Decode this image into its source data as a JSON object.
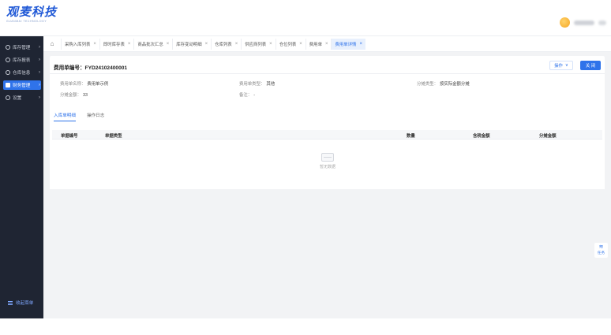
{
  "header": {
    "logo_text": "观麦科技",
    "logo_sub": "GUANMAI TECHNOLOGY"
  },
  "sidebar": {
    "items": [
      {
        "label": "库存管理",
        "icon": "box-icon",
        "active": false
      },
      {
        "label": "库存报表",
        "icon": "chart-icon",
        "active": false
      },
      {
        "label": "仓库信息",
        "icon": "warehouse-icon",
        "active": false
      },
      {
        "label": "财务管理",
        "icon": "finance-icon",
        "active": true
      },
      {
        "label": "设置",
        "icon": "gear-icon",
        "active": false
      }
    ],
    "collapse_label": "收起菜单"
  },
  "tabs": [
    {
      "label": "采购入库列表",
      "active": false
    },
    {
      "label": "即时库存表",
      "active": false
    },
    {
      "label": "商品批次汇总",
      "active": false
    },
    {
      "label": "库存变动明细",
      "active": false
    },
    {
      "label": "仓库列表",
      "active": false
    },
    {
      "label": "供应商列表",
      "active": false
    },
    {
      "label": "仓位列表",
      "active": false
    },
    {
      "label": "费用单",
      "active": false
    },
    {
      "label": "费用单详情",
      "active": true
    }
  ],
  "detail": {
    "title": "费用单编号：FYD24102400001",
    "ops_label": "操作",
    "close_label": "关 闭",
    "fields": {
      "company_label": "费用单名称：",
      "company_value": "费用单示例",
      "type_label": "费用单类型：",
      "type_value": "其他",
      "alloc_label": "分摊类型：",
      "alloc_value": "按实际金额分摊",
      "amount_label": "分摊金额：",
      "amount_value": "33",
      "remark_label": "备注：",
      "remark_value": "-"
    }
  },
  "subtabs": [
    {
      "label": "入库单明细",
      "active": true
    },
    {
      "label": "操作日志",
      "active": false
    }
  ],
  "table": {
    "columns": [
      "单据编号",
      "单据类型",
      "数量",
      "含税金额",
      "分摊金额"
    ],
    "empty_text": "暂无数据"
  },
  "float_button": {
    "label": "任务"
  }
}
